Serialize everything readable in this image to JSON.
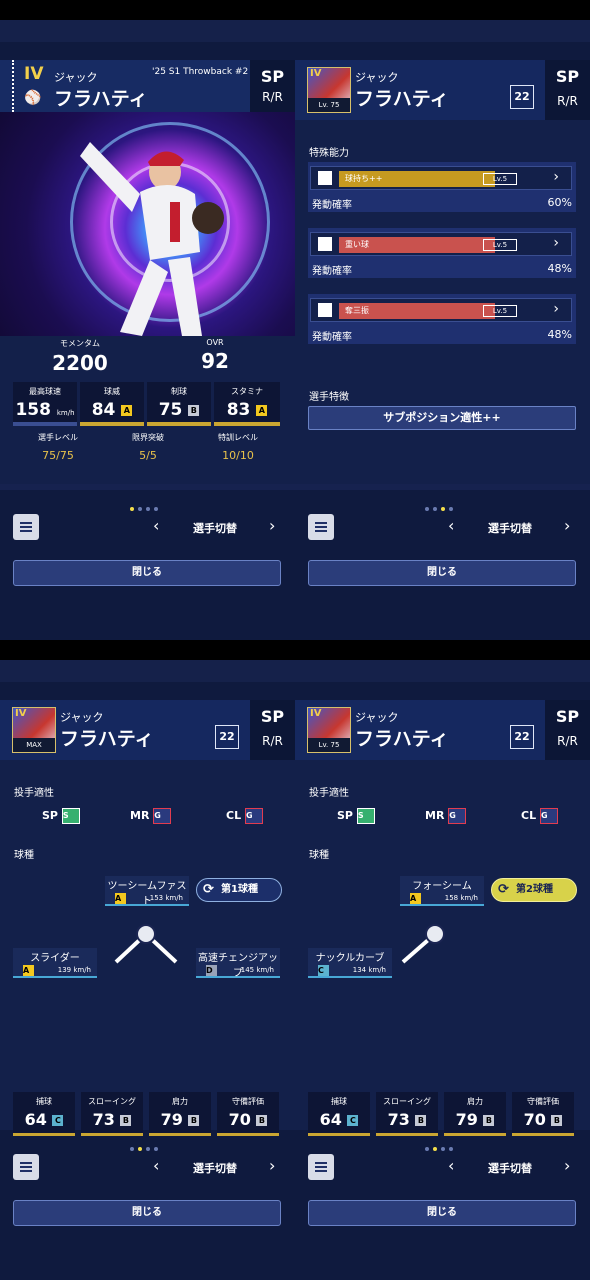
{
  "pages": [
    {
      "left": {
        "card": {
          "rank": "IV",
          "throwback": "'25 S1 Throwback #2",
          "name_small": "ジャック",
          "name_large": "フラハティ",
          "position": "SP",
          "handedness": "R/R"
        },
        "momentum_label": "モメンタム",
        "momentum": "2200",
        "ovr_label": "OVR",
        "ovr": "92",
        "stats": [
          {
            "label": "最高球速",
            "value": "158",
            "unit": "km/h",
            "grade": ""
          },
          {
            "label": "球威",
            "value": "84",
            "grade": "A"
          },
          {
            "label": "制球",
            "value": "75",
            "grade": "B"
          },
          {
            "label": "スタミナ",
            "value": "83",
            "grade": "A"
          }
        ],
        "levels": [
          {
            "label": "選手レベル",
            "value": "75/75"
          },
          {
            "label": "限界突破",
            "value": "5/5"
          },
          {
            "label": "特訓レベル",
            "value": "10/10"
          }
        ]
      },
      "right": {
        "header": {
          "name_small": "ジャック",
          "name_large": "フラハティ",
          "number": "22",
          "position": "SP",
          "handedness": "R/R",
          "avatar_caption": "Lv. 75",
          "avatar_rank": "IV"
        },
        "section_title": "特殊能力",
        "skills": [
          {
            "name": "球持ち++",
            "level": "Lv.5",
            "prob_label": "発動確率",
            "prob": "60%",
            "color": "#c69a20"
          },
          {
            "name": "重い球",
            "level": "Lv.5",
            "prob_label": "発動確率",
            "prob": "48%",
            "color": "#c9524e"
          },
          {
            "name": "奪三振",
            "level": "Lv.5",
            "prob_label": "発動確率",
            "prob": "48%",
            "color": "#c9524e"
          }
        ],
        "trait_title": "選手特徴",
        "trait_button": "サブポジション適性++"
      },
      "left_dots_active": 0,
      "right_dots_active": 2
    }
  ],
  "pitch_pages": [
    {
      "header": {
        "name_small": "ジャック",
        "name_large": "フラハティ",
        "number": "22",
        "position": "SP",
        "handedness": "R/R",
        "avatar_caption": "MAX",
        "avatar_rank": "IV"
      },
      "aptitude_title": "投手適性",
      "aptitudes": [
        {
          "pos": "SP",
          "grade": "S"
        },
        {
          "pos": "MR",
          "grade": "G"
        },
        {
          "pos": "CL",
          "grade": "G"
        }
      ],
      "pitch_title": "球種",
      "main_pitch": {
        "name": "ツーシームファスト",
        "grade": "A",
        "speed": "153 km/h",
        "badge": "第1球種"
      },
      "pitches": [
        {
          "name": "スライダー",
          "grade": "A",
          "speed": "139 km/h"
        },
        {
          "name": "高速チェンジアップ",
          "grade": "D",
          "speed": "145 km/h"
        }
      ],
      "field": [
        {
          "label": "捕球",
          "value": "64",
          "grade": "C"
        },
        {
          "label": "スローイング",
          "value": "73",
          "grade": "B"
        },
        {
          "label": "肩力",
          "value": "79",
          "grade": "B"
        },
        {
          "label": "守備評価",
          "value": "70",
          "grade": "B"
        }
      ],
      "dots_active": 1
    },
    {
      "header": {
        "name_small": "ジャック",
        "name_large": "フラハティ",
        "number": "22",
        "position": "SP",
        "handedness": "R/R",
        "avatar_caption": "Lv. 75",
        "avatar_rank": "IV"
      },
      "aptitude_title": "投手適性",
      "aptitudes": [
        {
          "pos": "SP",
          "grade": "S"
        },
        {
          "pos": "MR",
          "grade": "G"
        },
        {
          "pos": "CL",
          "grade": "G"
        }
      ],
      "pitch_title": "球種",
      "main_pitch": {
        "name": "フォーシーム",
        "grade": "A",
        "speed": "158 km/h",
        "badge": "第2球種"
      },
      "pitches": [
        {
          "name": "ナックルカーブ",
          "grade": "C",
          "speed": "134 km/h"
        }
      ],
      "field": [
        {
          "label": "捕球",
          "value": "64",
          "grade": "C"
        },
        {
          "label": "スローイング",
          "value": "73",
          "grade": "B"
        },
        {
          "label": "肩力",
          "value": "79",
          "grade": "B"
        },
        {
          "label": "守備評価",
          "value": "70",
          "grade": "B"
        }
      ],
      "dots_active": 1
    }
  ],
  "controls": {
    "switch_label": "選手切替",
    "close_label": "閉じる"
  },
  "colors": {
    "accent_gold": "#f2cf4b",
    "panel": "#13204a",
    "active_dot": "#f2dd4b",
    "badge_green": "#d8d24a"
  }
}
